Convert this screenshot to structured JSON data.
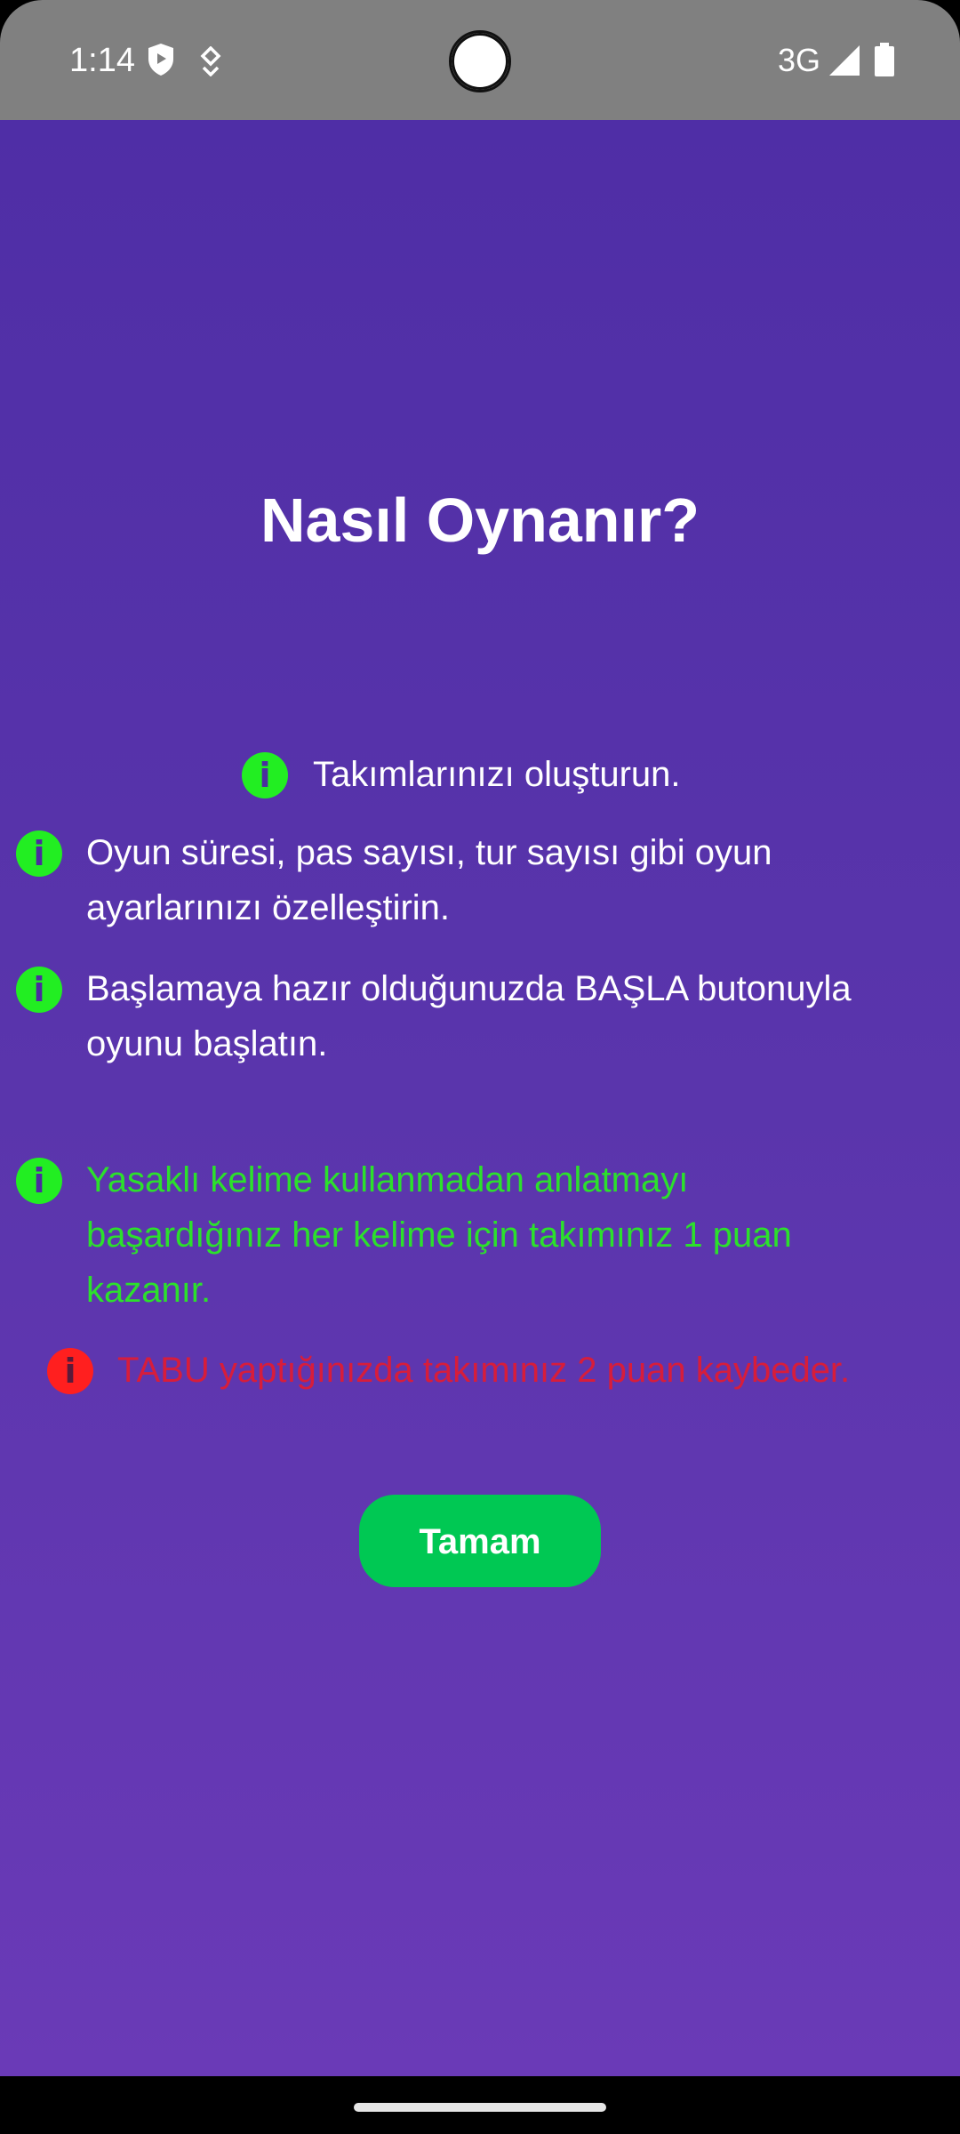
{
  "status_bar": {
    "time": "1:14",
    "network": "3G",
    "icons": [
      "shield-icon",
      "location-icon",
      "signal-icon",
      "battery-icon"
    ]
  },
  "dialog": {
    "title": "Nasıl Oynanır?",
    "items": [
      {
        "text": "Takımlarınızı oluşturun.",
        "type": "info"
      },
      {
        "text": "Oyun süresi, pas sayısı, tur sayısı gibi oyun\nayarlarınızı özelleştirin.",
        "type": "info"
      },
      {
        "text": "Başlamaya hazır olduğunuzda BAŞLA butonuyla\noyunu başlatın.",
        "type": "info"
      },
      {
        "text": "Yasaklı kelime kullanmadan anlatmayı\nbaşardığınız her kelime için takımınız 1 puan\nkazanır.",
        "type": "success"
      },
      {
        "text": "TABU yaptığınızda takımınız 2 puan kaybeder.",
        "type": "error"
      }
    ],
    "icon_glyph": "i",
    "ok_label": "Tamam"
  },
  "colors": {
    "background_top": "#4f2ea6",
    "background_bottom": "#6a3ab7",
    "info_icon": "#22ee22",
    "success_text": "#2ce02c",
    "error": "#ff1f1f",
    "button": "#00c853"
  }
}
